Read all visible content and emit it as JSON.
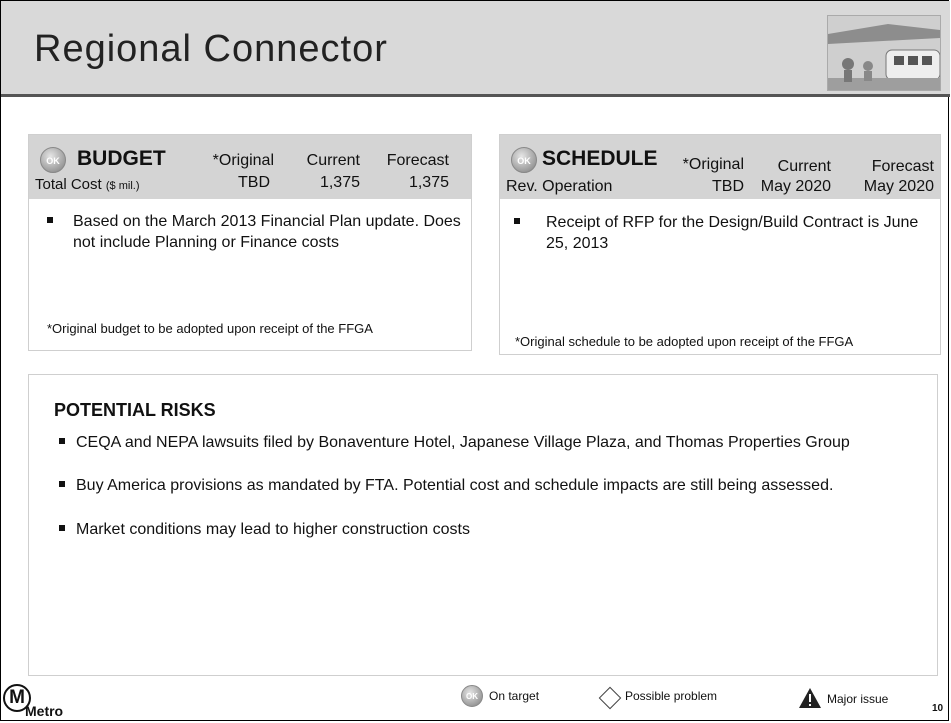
{
  "title": "Regional Connector",
  "budget": {
    "ok_label": "OK",
    "heading": "BUDGET",
    "row_label": "Total Cost",
    "row_unit": "($ mil.)",
    "columns": [
      {
        "header": "*Original",
        "value": "TBD"
      },
      {
        "header": "Current",
        "value": "1,375"
      },
      {
        "header": "Forecast",
        "value": "1,375"
      }
    ],
    "bullets": [
      "Based on the March 2013 Financial Plan update. Does not include Planning or Finance costs"
    ],
    "note": "*Original budget to be adopted upon receipt of the FFGA"
  },
  "schedule": {
    "ok_label": "OK",
    "heading": "SCHEDULE",
    "row_label": "Rev. Operation",
    "columns": [
      {
        "header": "*Original",
        "value": "TBD"
      },
      {
        "header": "Current",
        "value": "May 2020"
      },
      {
        "header": "Forecast",
        "value": "May 2020"
      }
    ],
    "bullets": [
      "Receipt of RFP for the Design/Build Contract is June 25, 2013"
    ],
    "note": "*Original schedule to be adopted upon receipt of the FFGA"
  },
  "risks": {
    "heading": "POTENTIAL RISKS",
    "items": [
      "CEQA and NEPA lawsuits filed by Bonaventure Hotel, Japanese Village Plaza, and Thomas Properties Group",
      "Buy America provisions as mandated by FTA. Potential cost and schedule impacts are still being assessed.",
      "Market conditions may lead to higher construction costs"
    ]
  },
  "footer": {
    "logo_letter": "M",
    "logo_text": "Metro",
    "legend": [
      {
        "icon": "ok-icon",
        "label": "On target"
      },
      {
        "icon": "diamond-icon",
        "label": "Possible problem"
      },
      {
        "icon": "warning-triangle-icon",
        "label": "Major issue"
      }
    ],
    "page_number": "10"
  },
  "colors": {
    "header_bg": "#d9d9d9",
    "panel_head_bg": "#d4d4d4",
    "border": "#cfcfcf"
  }
}
